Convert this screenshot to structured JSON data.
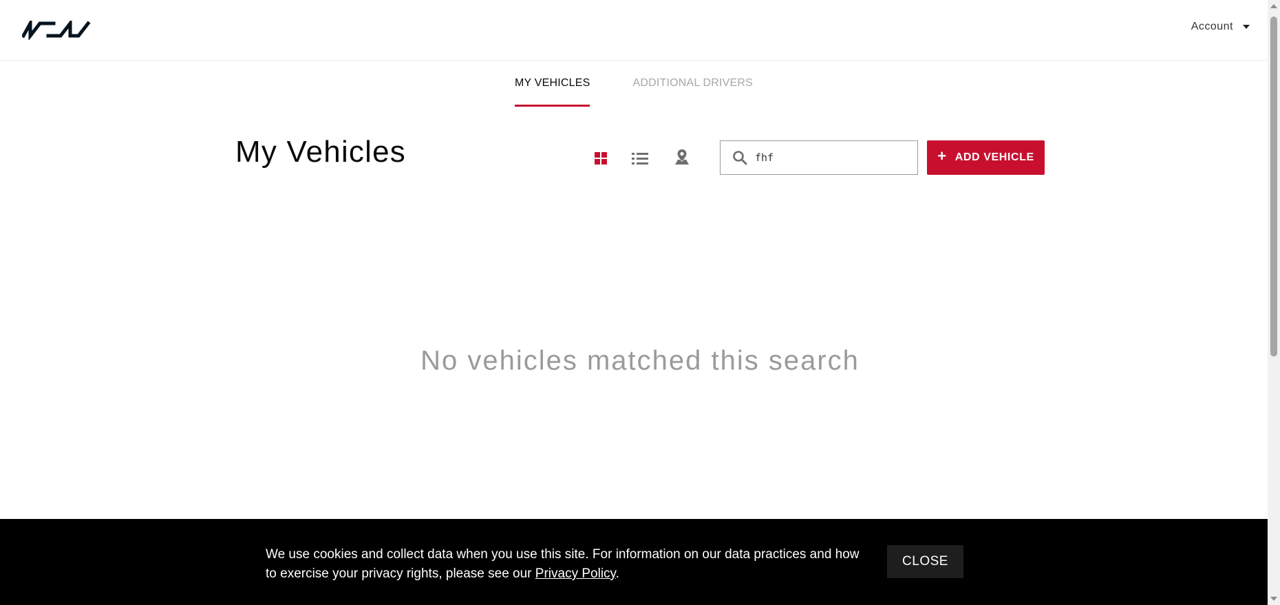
{
  "header": {
    "brand": "KIA",
    "account_label": "Account"
  },
  "tabs": [
    {
      "label": "MY VEHICLES",
      "active": true
    },
    {
      "label": "ADDITIONAL DRIVERS",
      "active": false
    }
  ],
  "main": {
    "title": "My Vehicles",
    "view_modes": [
      {
        "icon": "grid-icon",
        "active": true
      },
      {
        "icon": "list-icon",
        "active": false
      },
      {
        "icon": "map-pin-icon",
        "active": false
      }
    ],
    "search": {
      "value": "fhf",
      "placeholder": ""
    },
    "add_vehicle_label": "ADD VEHICLE",
    "empty_message": "No vehicles matched this search"
  },
  "cookie_banner": {
    "text_before": "We use cookies and collect data when you use this site. For information on our data practices and how to exercise your privacy rights, please see our ",
    "link_label": "Privacy Policy",
    "text_after": ".",
    "close_label": "CLOSE"
  },
  "colors": {
    "accent": "#c8102e",
    "active_icon": "#c8102e",
    "inactive_icon": "#6f6f6f",
    "banner_bg": "#000000",
    "muted_text": "#9a9a9a"
  }
}
